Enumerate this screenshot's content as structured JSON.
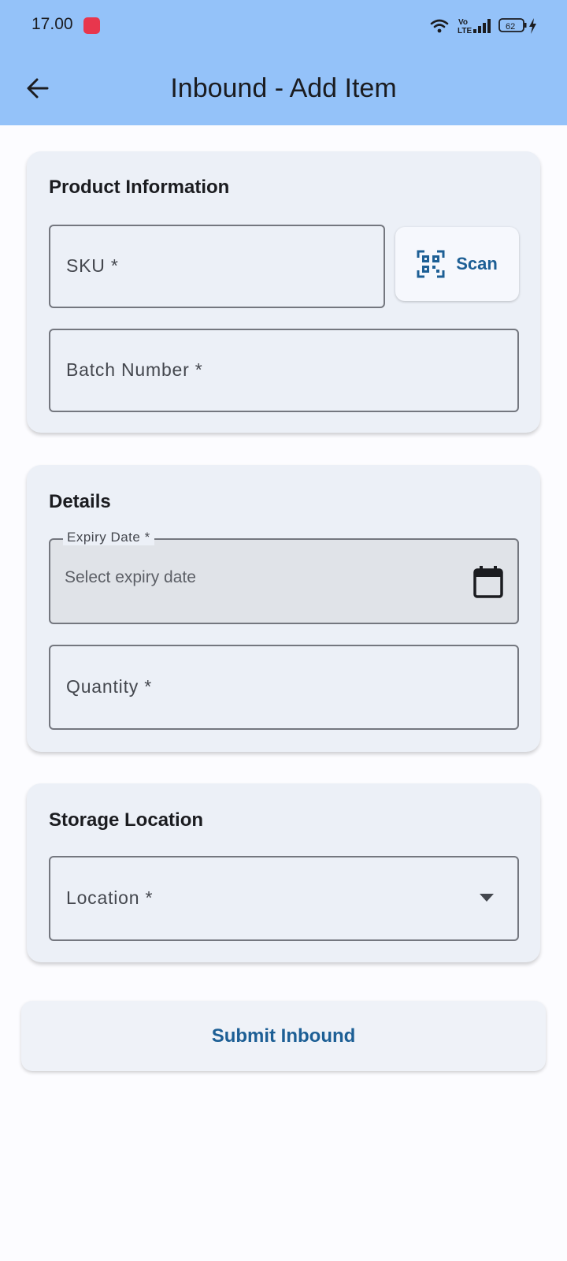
{
  "status_bar": {
    "time": "17.00",
    "network_label": "Vo LTE",
    "battery_level": "62"
  },
  "app_bar": {
    "title": "Inbound - Add Item",
    "back_icon": "arrow-left-icon"
  },
  "product_card": {
    "title": "Product Information",
    "sku_label": "SKU *",
    "scan_label": "Scan",
    "scan_icon": "qr-code-scanner-icon",
    "batch_label": "Batch Number *"
  },
  "details_card": {
    "title": "Details",
    "expiry_label": "Expiry Date *",
    "expiry_placeholder": "Select expiry date",
    "expiry_icon": "calendar-icon",
    "quantity_label": "Quantity *"
  },
  "storage_card": {
    "title": "Storage Location",
    "location_label": "Location *",
    "location_icon": "dropdown-arrow-icon"
  },
  "submit": {
    "label": "Submit Inbound"
  },
  "colors": {
    "app_bar": "#94c2f9",
    "card_bg": "#ecf0f7",
    "accent": "#1d5f95",
    "outline": "#74777f",
    "status_badge": "#e8364d"
  }
}
